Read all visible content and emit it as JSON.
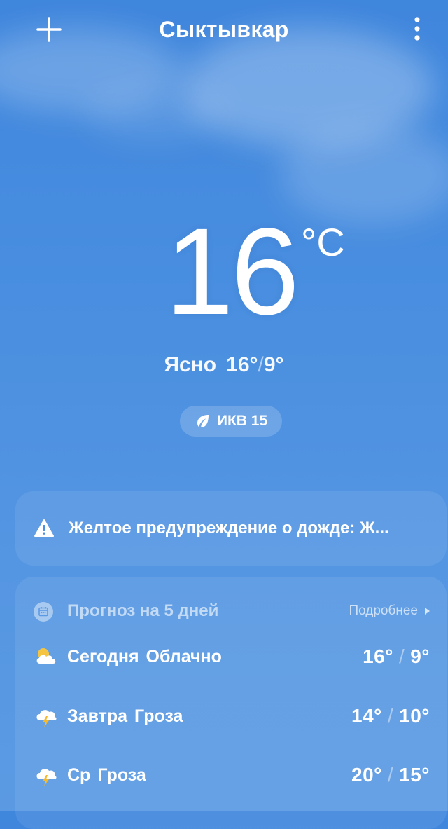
{
  "header": {
    "city": "Сыктывкар"
  },
  "current": {
    "temperature": "16",
    "unit": "°C",
    "condition": "Ясно",
    "high": "16°",
    "low": "9°",
    "aqi_label": "ИКВ 15"
  },
  "alert": {
    "text": "Желтое предупреждение о дожде: Ж..."
  },
  "forecast": {
    "title": "Прогноз на 5 дней",
    "more_label": "Подробнее",
    "days": [
      {
        "day": "Сегодня",
        "condition": "Облачно",
        "high": "16°",
        "low": "9°",
        "icon": "partly-cloudy-icon"
      },
      {
        "day": "Завтра",
        "condition": "Гроза",
        "high": "14°",
        "low": "10°",
        "icon": "thunderstorm-icon"
      },
      {
        "day": "Ср",
        "condition": "Гроза",
        "high": "20°",
        "low": "15°",
        "icon": "thunderstorm-icon"
      }
    ]
  },
  "colors": {
    "sky_top": "#3f86dd",
    "sky_bottom": "#5b9ae3",
    "sun": "#f5c542",
    "bolt": "#f5b92e"
  }
}
